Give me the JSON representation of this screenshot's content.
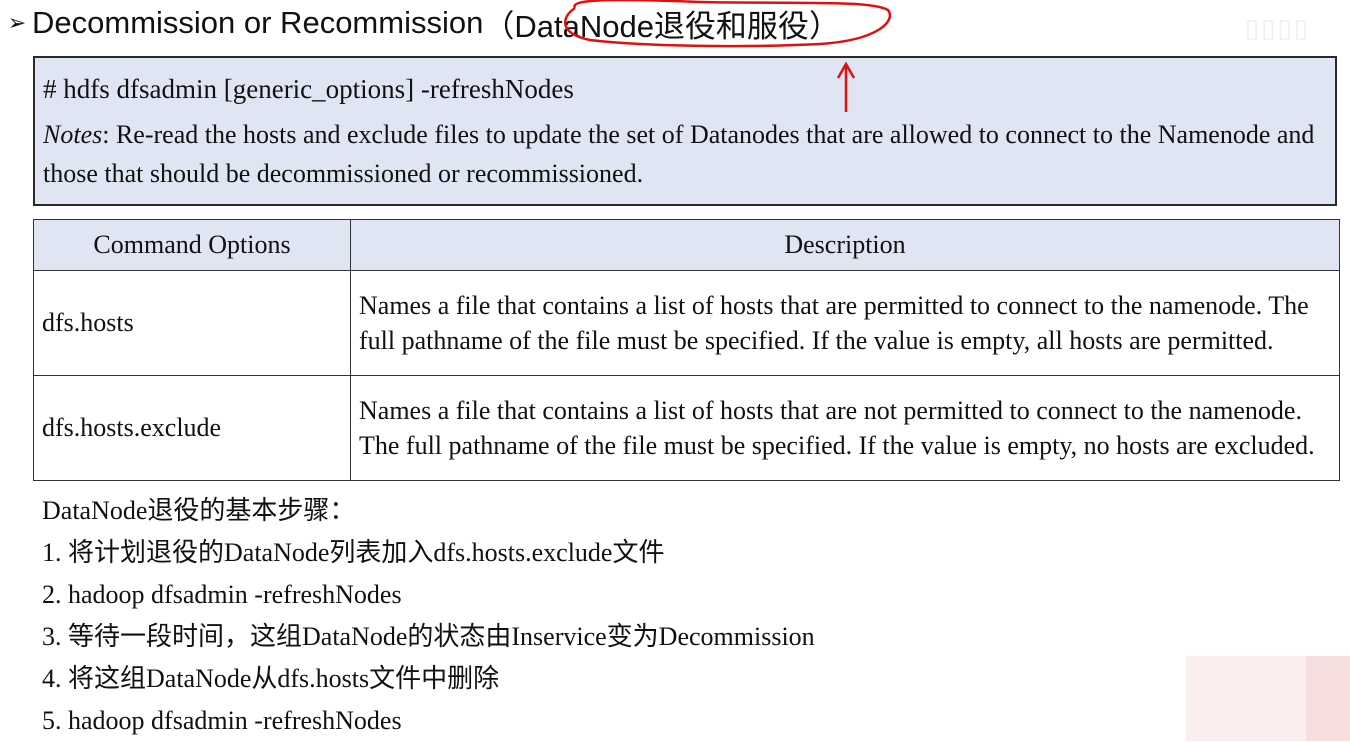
{
  "heading": {
    "title": "Decommission or Recommission",
    "paren_open": "（",
    "highlight": "DataNode退役和服役",
    "paren_close": "）"
  },
  "command_box": {
    "command": "# hdfs  dfsadmin  [generic_options]  -refreshNodes",
    "notes_label": "Notes",
    "notes_text": ": Re-read the hosts and exclude files to update the set of Datanodes that are allowed to connect to the Namenode and those that should be decommissioned or recommissioned."
  },
  "table": {
    "headers": [
      "Command Options",
      "Description"
    ],
    "rows": [
      {
        "option": "dfs.hosts",
        "description": "Names a file that contains a list of hosts that are permitted to connect to the namenode. The full pathname of the file must be specified. If the value is empty, all hosts are permitted."
      },
      {
        "option": "dfs.hosts.exclude",
        "description": "Names a file that contains a list of hosts that are not permitted to connect to the namenode. The full pathname of the file must be specified. If the value is empty, no hosts are excluded."
      }
    ]
  },
  "steps": {
    "title": "DataNode退役的基本步骤：",
    "items": [
      "1. 将计划退役的DataNode列表加入dfs.hosts.exclude文件",
      "2. hadoop dfsadmin -refreshNodes",
      "3. 等待一段时间，这组DataNode的状态由Inservice变为Decommission",
      "4. 将这组DataNode从dfs.hosts文件中删除",
      "5. hadoop dfsadmin -refreshNodes"
    ]
  },
  "colors": {
    "box_fill": "#dfe5f3",
    "annotation": "#e01010"
  }
}
